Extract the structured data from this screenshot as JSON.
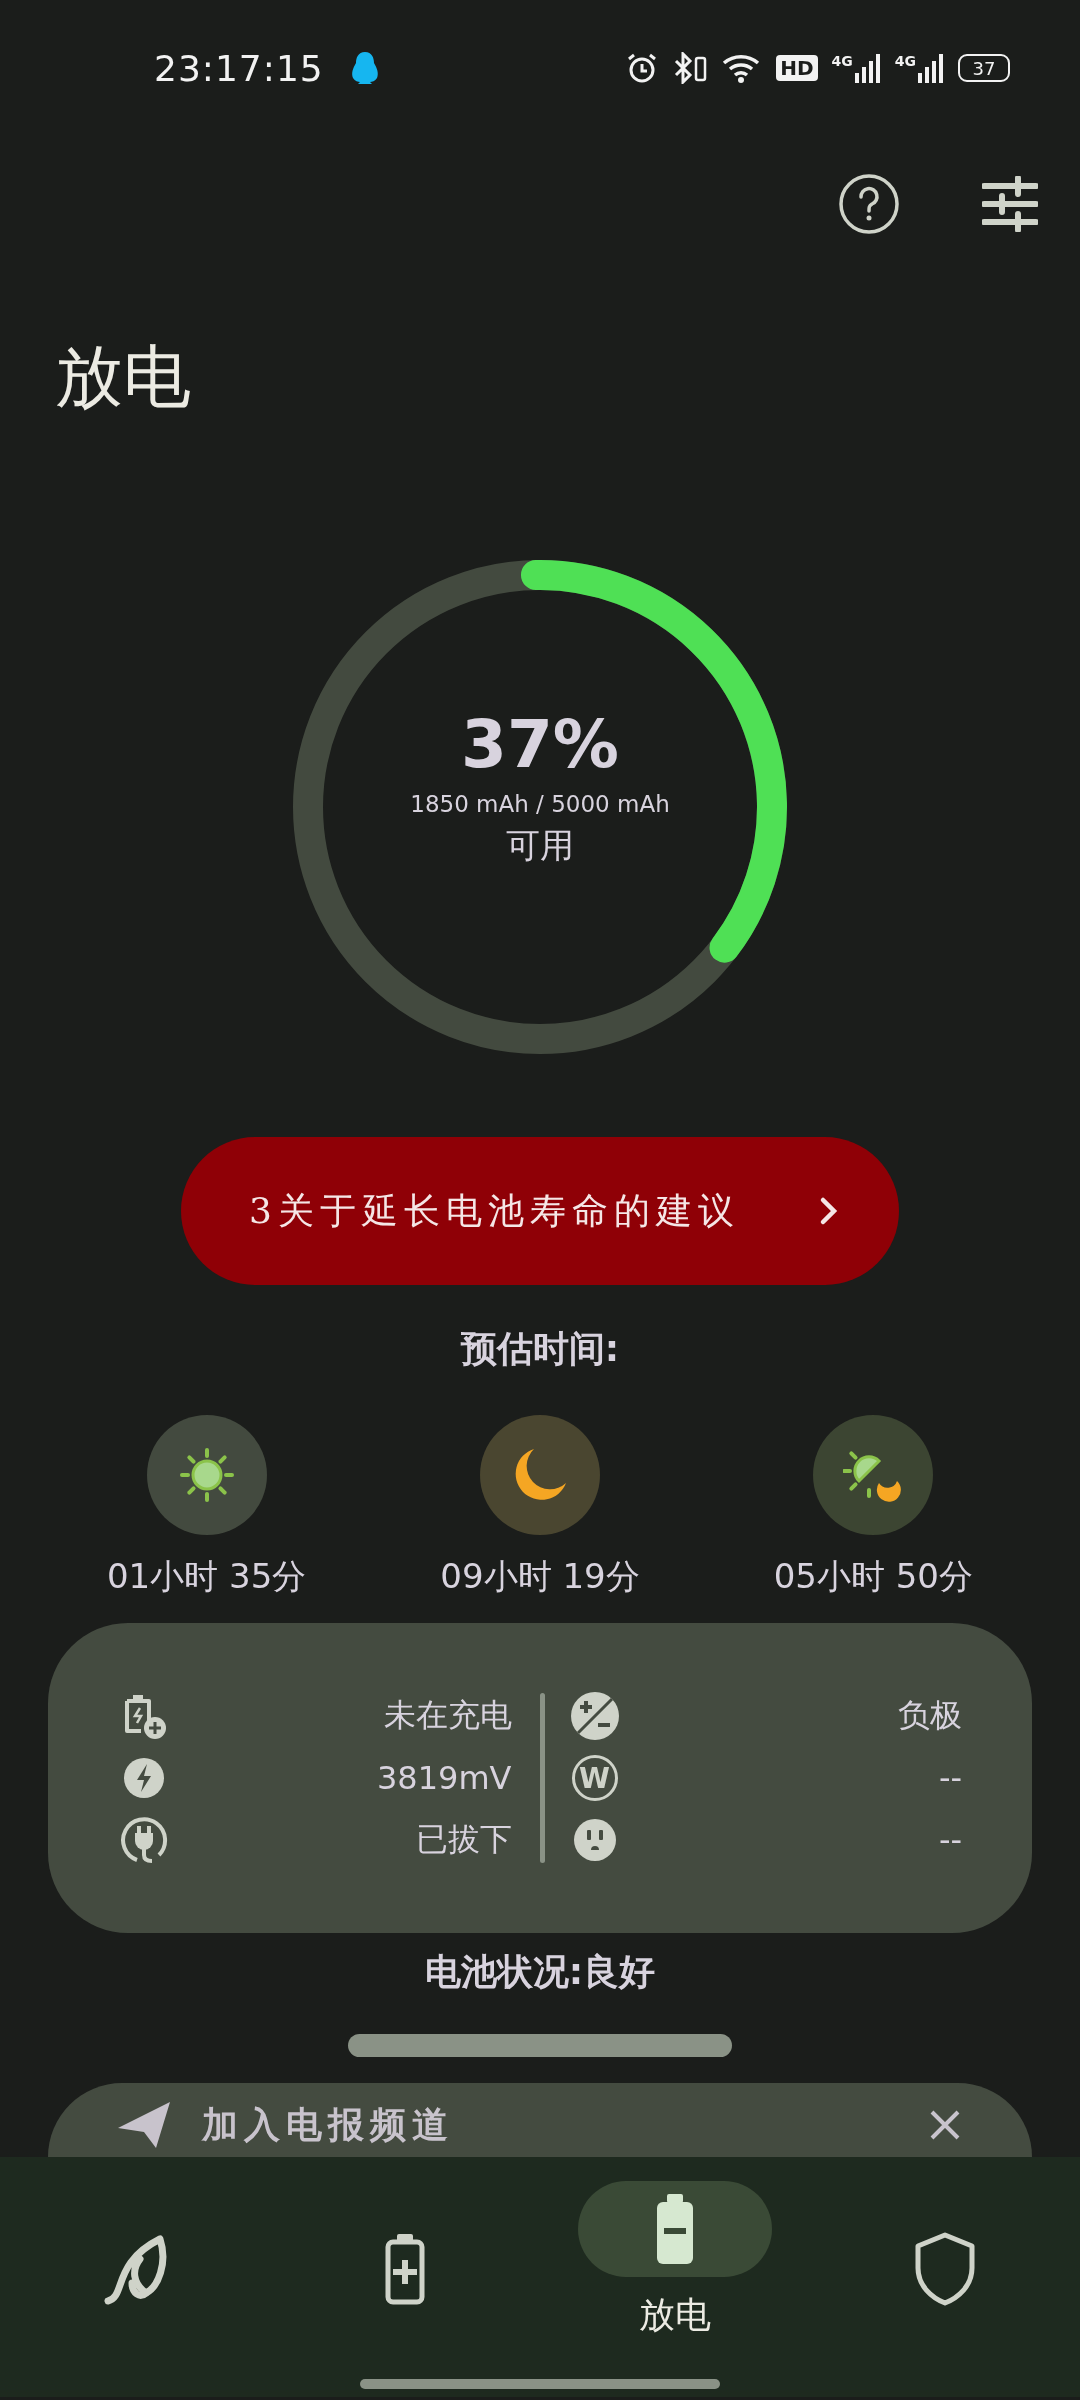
{
  "status_bar": {
    "time": "23:17:15",
    "hd": "HD",
    "signals": [
      {
        "label": "4G"
      },
      {
        "label": "4G"
      }
    ],
    "battery": "37"
  },
  "title": "放电",
  "gauge": {
    "level": 0.37,
    "percent": "37%",
    "capacity": "1850 mAh / 5000 mAh",
    "label": "可用"
  },
  "tip_banner": {
    "text": "3关于延长电池寿命的建议"
  },
  "estimate": {
    "title": "预估时间:",
    "items": [
      {
        "kind": "day",
        "time": "01小时 35分"
      },
      {
        "kind": "night",
        "time": "09小时 19分"
      },
      {
        "kind": "mixed",
        "time": "05小时 50分"
      }
    ]
  },
  "info_card": {
    "left": [
      {
        "kind": "charging",
        "value": "未在充电"
      },
      {
        "kind": "voltage",
        "value": "3819mV"
      },
      {
        "kind": "plug",
        "value": "已拔下"
      }
    ],
    "right": [
      {
        "kind": "polarity",
        "value": "负极"
      },
      {
        "kind": "watt",
        "symbol": "W",
        "value": "--"
      },
      {
        "kind": "outlet",
        "value": "--"
      }
    ]
  },
  "health": "电池状况:良好",
  "telegram_card": {
    "text": "加入电报频道"
  },
  "nav": [
    {
      "kind": "leaf",
      "selected": false
    },
    {
      "kind": "charge",
      "selected": false
    },
    {
      "kind": "discharge",
      "selected": true,
      "label": "放电"
    },
    {
      "kind": "shield",
      "selected": false
    }
  ]
}
